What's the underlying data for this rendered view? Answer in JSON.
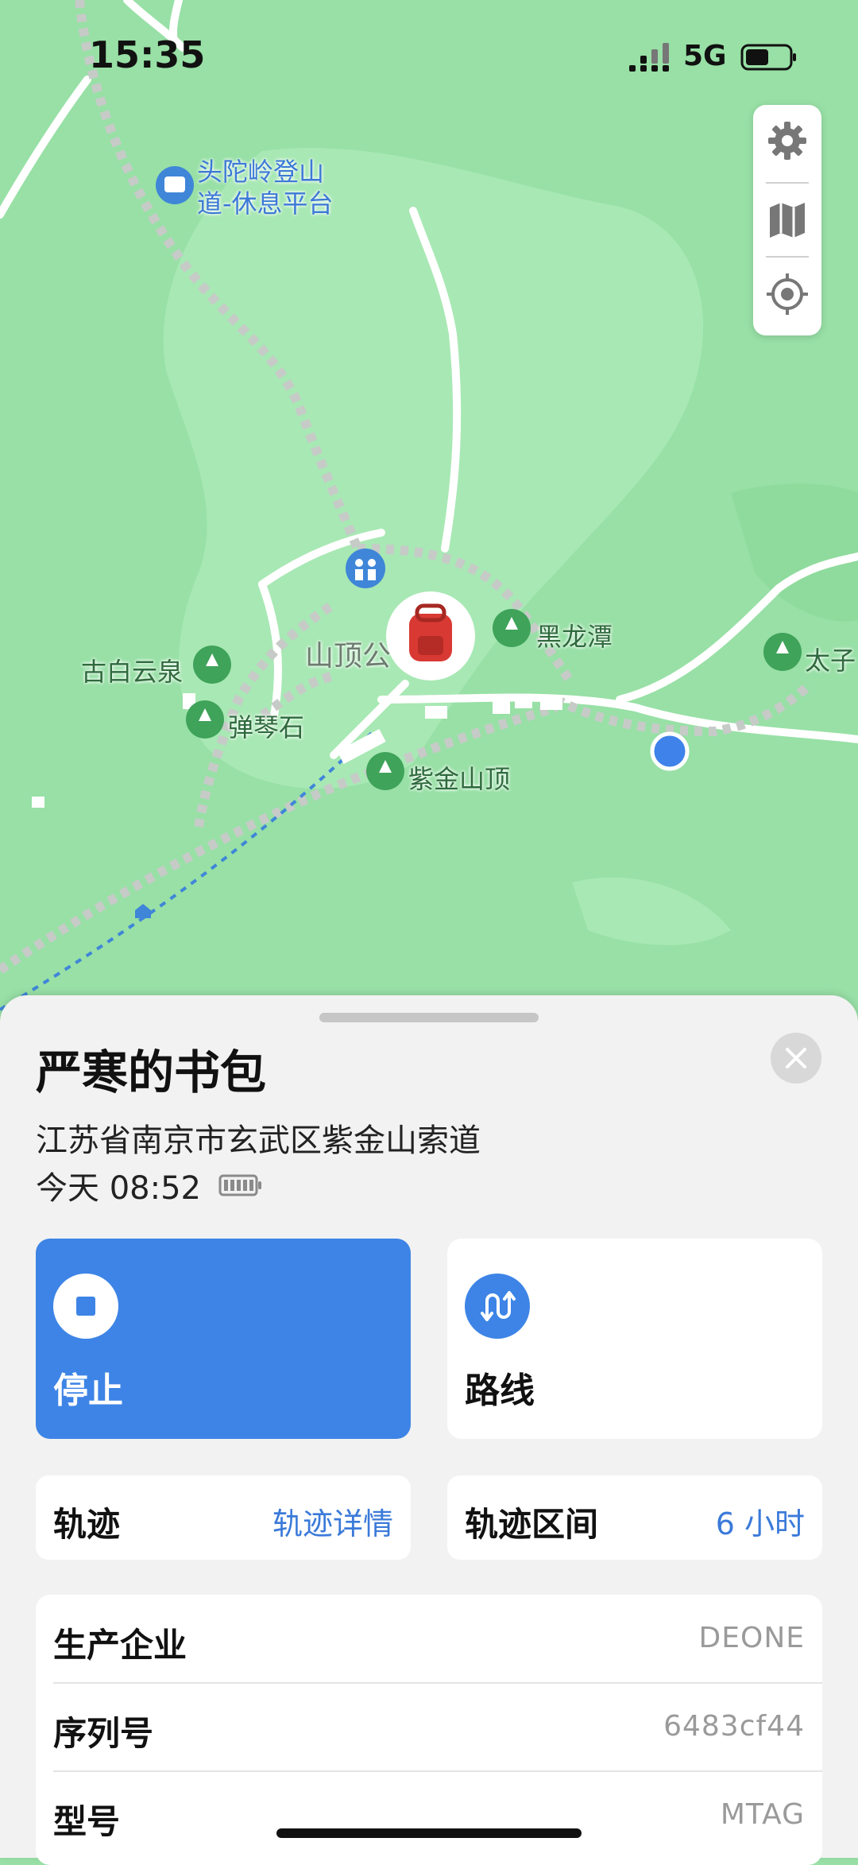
{
  "status_bar": {
    "time": "15:35",
    "network": "5G"
  },
  "map": {
    "poi_rest_platform": [
      "头陀岭登山",
      "道-休息平台"
    ],
    "poi_heilongtan": "黑龙潭",
    "poi_gubaiyunquan": "古白云泉",
    "poi_tanqinshi": "弹琴石",
    "poi_zijinshanding": "紫金山顶",
    "poi_taizi": "太子",
    "poi_shanding": "山顶公"
  },
  "map_controls": {
    "settings_icon": "gear-icon",
    "map_icon": "map-icon",
    "locate_icon": "location-target-icon"
  },
  "sheet": {
    "title": "严寒的书包",
    "address": "江苏省南京市玄武区紫金山索道",
    "last_seen": "今天 08:52",
    "actions": [
      {
        "label": "停止",
        "icon": "stop-icon"
      },
      {
        "label": "路线",
        "icon": "route-icon"
      }
    ],
    "track": {
      "label": "轨迹",
      "link": "轨迹详情"
    },
    "track_range": {
      "label": "轨迹区间",
      "value": "6 小时"
    },
    "info": [
      {
        "key": "生产企业",
        "value": "DEONE"
      },
      {
        "key": "序列号",
        "value": "6483cf44"
      },
      {
        "key": "型号",
        "value": "MTAG"
      }
    ]
  },
  "colors": {
    "accent": "#3d84e6",
    "map_green": "#98e0a6"
  }
}
